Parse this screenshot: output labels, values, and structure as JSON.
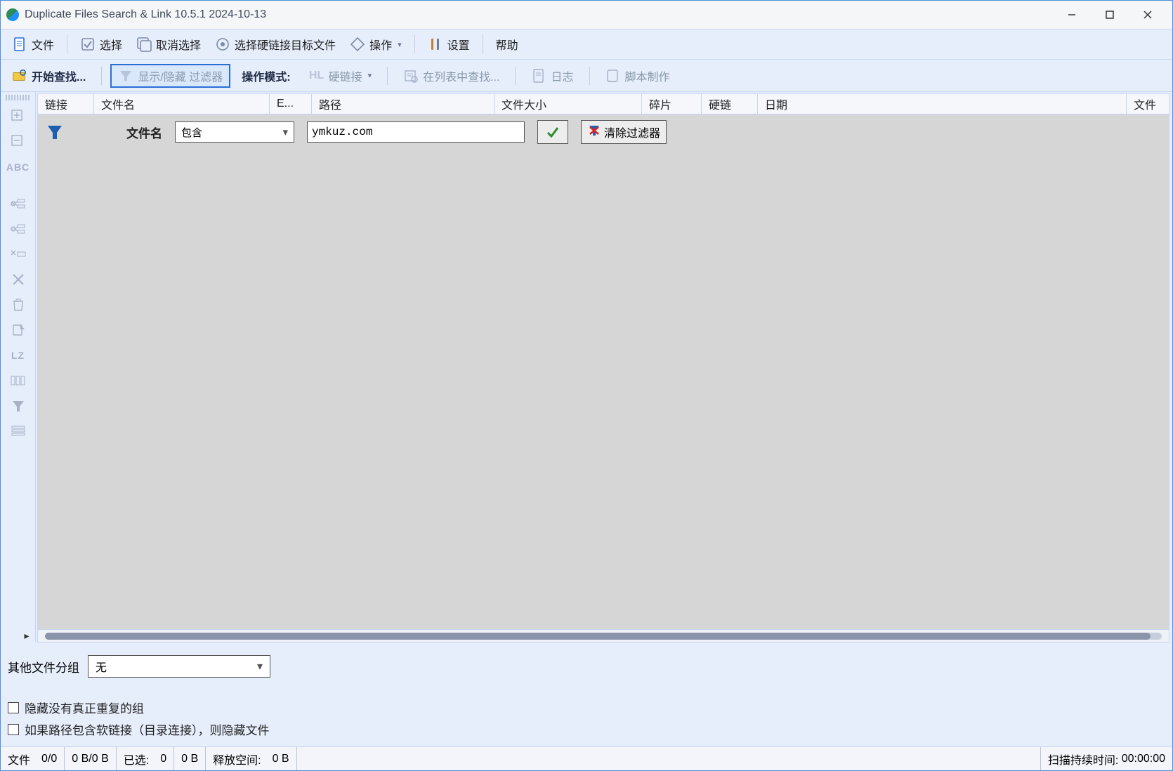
{
  "window": {
    "title": "Duplicate Files Search & Link 10.5.1 2024-10-13"
  },
  "menubar": {
    "file": "文件",
    "select": "选择",
    "deselect": "取消选择",
    "choose_hardlink_target": "选择硬链接目标文件",
    "actions": "操作",
    "settings": "设置",
    "help": "帮助"
  },
  "toolbar": {
    "start_search": "开始查找...",
    "show_hide_filter": "显示/隐藏 过滤器",
    "mode_label": "操作模式:",
    "hardlink": "硬链接",
    "find_in_list": "在列表中查找...",
    "log": "日志",
    "script": "脚本制作"
  },
  "columns": {
    "link": "链接",
    "filename": "文件名",
    "ext": "E...",
    "path": "路径",
    "filesize": "文件大小",
    "fragments": "碎片",
    "hardlinks": "硬链",
    "date": "日期",
    "file": "文件"
  },
  "filter": {
    "field_label": "文件名",
    "mode_selected": "包含",
    "text_value": "ymkuz.com",
    "clear_label": "清除过滤器"
  },
  "sidebar": {
    "lz": "LZ"
  },
  "footer": {
    "group_label": "其他文件分组",
    "group_selected": "无",
    "hide_nondup": "隐藏没有真正重复的组",
    "hide_softlink": "如果路径包含软链接（目录连接），则隐藏文件"
  },
  "status": {
    "files_label": "文件",
    "files_count": "0/0",
    "files_size": "0 B/0 B",
    "selected_label": "已选:",
    "selected_count": "0",
    "selected_size": "0 B",
    "free_label": "释放空间:",
    "free_size": "0 B",
    "scan_label": "扫描持续时间:",
    "scan_time": "00:00:00"
  }
}
